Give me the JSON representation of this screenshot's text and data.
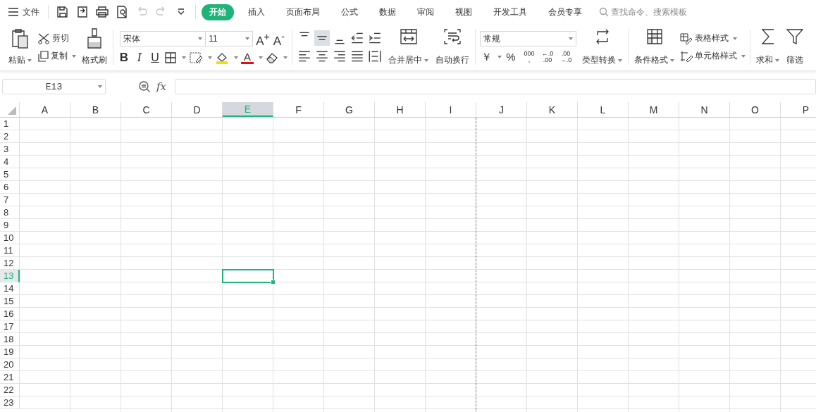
{
  "menu": {
    "label": "文件"
  },
  "quick_access": [
    {
      "kind": "save",
      "disabled": false
    },
    {
      "kind": "export",
      "disabled": false
    },
    {
      "kind": "print",
      "disabled": false
    },
    {
      "kind": "preview",
      "disabled": false
    },
    {
      "kind": "undo",
      "disabled": true
    },
    {
      "kind": "redo",
      "disabled": true
    },
    {
      "kind": "more",
      "disabled": false
    }
  ],
  "tabs": [
    {
      "label": "开始",
      "selected": true
    },
    {
      "label": "插入",
      "selected": false
    },
    {
      "label": "页面布局",
      "selected": false
    },
    {
      "label": "公式",
      "selected": false
    },
    {
      "label": "数据",
      "selected": false
    },
    {
      "label": "审阅",
      "selected": false
    },
    {
      "label": "视图",
      "selected": false
    },
    {
      "label": "开发工具",
      "selected": false
    },
    {
      "label": "会员专享",
      "selected": false
    }
  ],
  "search": {
    "placeholder": "查找命令、搜索模板"
  },
  "clipboard": {
    "paste": "粘贴",
    "cut": "剪切",
    "copy": "复制",
    "format_painter": "格式刷"
  },
  "font": {
    "name": "宋体",
    "size": "11",
    "grow": "A$^{+}$",
    "shrink": "A$^{-}$",
    "bold": "B",
    "italic": "I",
    "underline": "U",
    "font_color_label": "A"
  },
  "align_buttons": [
    {
      "kind": "top",
      "selected": false
    },
    {
      "kind": "middle",
      "selected": true
    },
    {
      "kind": "bottom",
      "selected": false
    },
    {
      "kind": "outdent",
      "selected": false
    },
    {
      "kind": "indent",
      "selected": false
    },
    {
      "kind": "left",
      "selected": false
    },
    {
      "kind": "center",
      "selected": false
    },
    {
      "kind": "right",
      "selected": false
    },
    {
      "kind": "justify",
      "selected": false
    },
    {
      "kind": "distributed",
      "selected": false
    }
  ],
  "merge": {
    "label": "合并居中"
  },
  "wrap": {
    "label": "自动换行"
  },
  "number": {
    "format": "常规",
    "currency": "￥",
    "percent": "%",
    "thousands": "000",
    "thousands_mark": ",",
    "decimal_buttons": [
      {
        "top": "←.0",
        "bottom": ".00"
      },
      {
        "top": ".00",
        "bottom": "→.0"
      }
    ],
    "convert": "类型转换"
  },
  "styles": {
    "conditional": "条件格式",
    "table_style": "表格样式",
    "cell_style": "单元格样式"
  },
  "editing": {
    "sum": "求和",
    "filter": "筛选"
  },
  "name_box": "E13",
  "formula_label": "fx",
  "columns": [
    {
      "label": "A",
      "selected": false,
      "page_break": false
    },
    {
      "label": "B",
      "selected": false,
      "page_break": false
    },
    {
      "label": "C",
      "selected": false,
      "page_break": false
    },
    {
      "label": "D",
      "selected": false,
      "page_break": false
    },
    {
      "label": "E",
      "selected": true,
      "page_break": false
    },
    {
      "label": "F",
      "selected": false,
      "page_break": false
    },
    {
      "label": "G",
      "selected": false,
      "page_break": false
    },
    {
      "label": "H",
      "selected": false,
      "page_break": false
    },
    {
      "label": "I",
      "selected": false,
      "page_break": true
    },
    {
      "label": "J",
      "selected": false,
      "page_break": false
    },
    {
      "label": "K",
      "selected": false,
      "page_break": false
    },
    {
      "label": "L",
      "selected": false,
      "page_break": false
    },
    {
      "label": "M",
      "selected": false,
      "page_break": false
    },
    {
      "label": "N",
      "selected": false,
      "page_break": false
    },
    {
      "label": "O",
      "selected": false,
      "page_break": false
    },
    {
      "label": "P",
      "selected": false,
      "page_break": false
    }
  ],
  "rows": [
    {
      "label": "1",
      "selected": false
    },
    {
      "label": "2",
      "selected": false
    },
    {
      "label": "3",
      "selected": false
    },
    {
      "label": "4",
      "selected": false
    },
    {
      "label": "5",
      "selected": false
    },
    {
      "label": "6",
      "selected": false
    },
    {
      "label": "7",
      "selected": false
    },
    {
      "label": "8",
      "selected": false
    },
    {
      "label": "9",
      "selected": false
    },
    {
      "label": "10",
      "selected": false
    },
    {
      "label": "11",
      "selected": false
    },
    {
      "label": "12",
      "selected": false
    },
    {
      "label": "13",
      "selected": true
    },
    {
      "label": "14",
      "selected": false
    },
    {
      "label": "15",
      "selected": false
    },
    {
      "label": "16",
      "selected": false
    },
    {
      "label": "17",
      "selected": false
    },
    {
      "label": "18",
      "selected": false
    },
    {
      "label": "19",
      "selected": false
    },
    {
      "label": "20",
      "selected": false
    },
    {
      "label": "21",
      "selected": false
    },
    {
      "label": "22",
      "selected": false
    },
    {
      "label": "23",
      "selected": false
    }
  ]
}
